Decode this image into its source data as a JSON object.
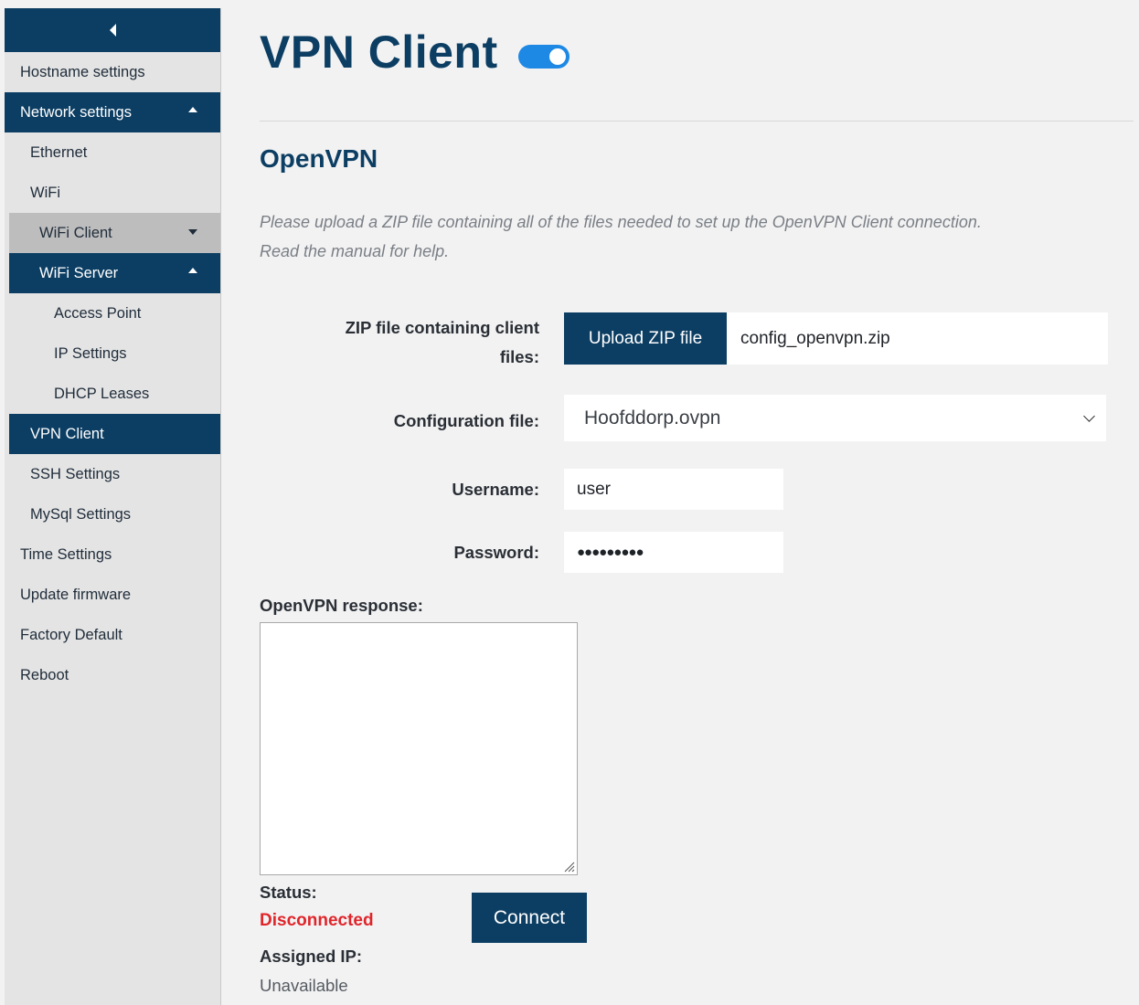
{
  "sidebar": {
    "items": [
      {
        "label": "Hostname settings"
      },
      {
        "label": "Network settings"
      },
      {
        "label": "Ethernet"
      },
      {
        "label": "WiFi"
      },
      {
        "label": "WiFi Client"
      },
      {
        "label": "WiFi Server"
      },
      {
        "label": "Access Point"
      },
      {
        "label": "IP Settings"
      },
      {
        "label": "DHCP Leases"
      },
      {
        "label": "VPN Client"
      },
      {
        "label": "SSH Settings"
      },
      {
        "label": "MySql Settings"
      },
      {
        "label": "Time Settings"
      },
      {
        "label": "Update firmware"
      },
      {
        "label": "Factory Default"
      },
      {
        "label": "Reboot"
      }
    ]
  },
  "main": {
    "title": "VPN Client",
    "toggle_on": true,
    "section_title": "OpenVPN",
    "help_line1": "Please upload a ZIP file containing all of the files needed to set up the OpenVPN Client connection.",
    "help_line2": "Read the manual for help.",
    "zip_label_line1": "ZIP file containing client",
    "zip_label_line2": "files:",
    "upload_button": "Upload ZIP file",
    "zip_filename": "config_openvpn.zip",
    "config_label": "Configuration file:",
    "config_value": "Hoofddorp.ovpn",
    "username_label": "Username:",
    "username_value": "user",
    "password_label": "Password:",
    "password_value": "●●●●●●●●●",
    "response_label": "OpenVPN response:",
    "status_label": "Status:",
    "status_value": "Disconnected",
    "connect_button": "Connect",
    "ip_label": "Assigned IP:",
    "ip_value": "Unavailable"
  },
  "colors": {
    "brand": "#0c3e63",
    "toggle": "#1e88e5",
    "status_error": "#e0252b"
  }
}
